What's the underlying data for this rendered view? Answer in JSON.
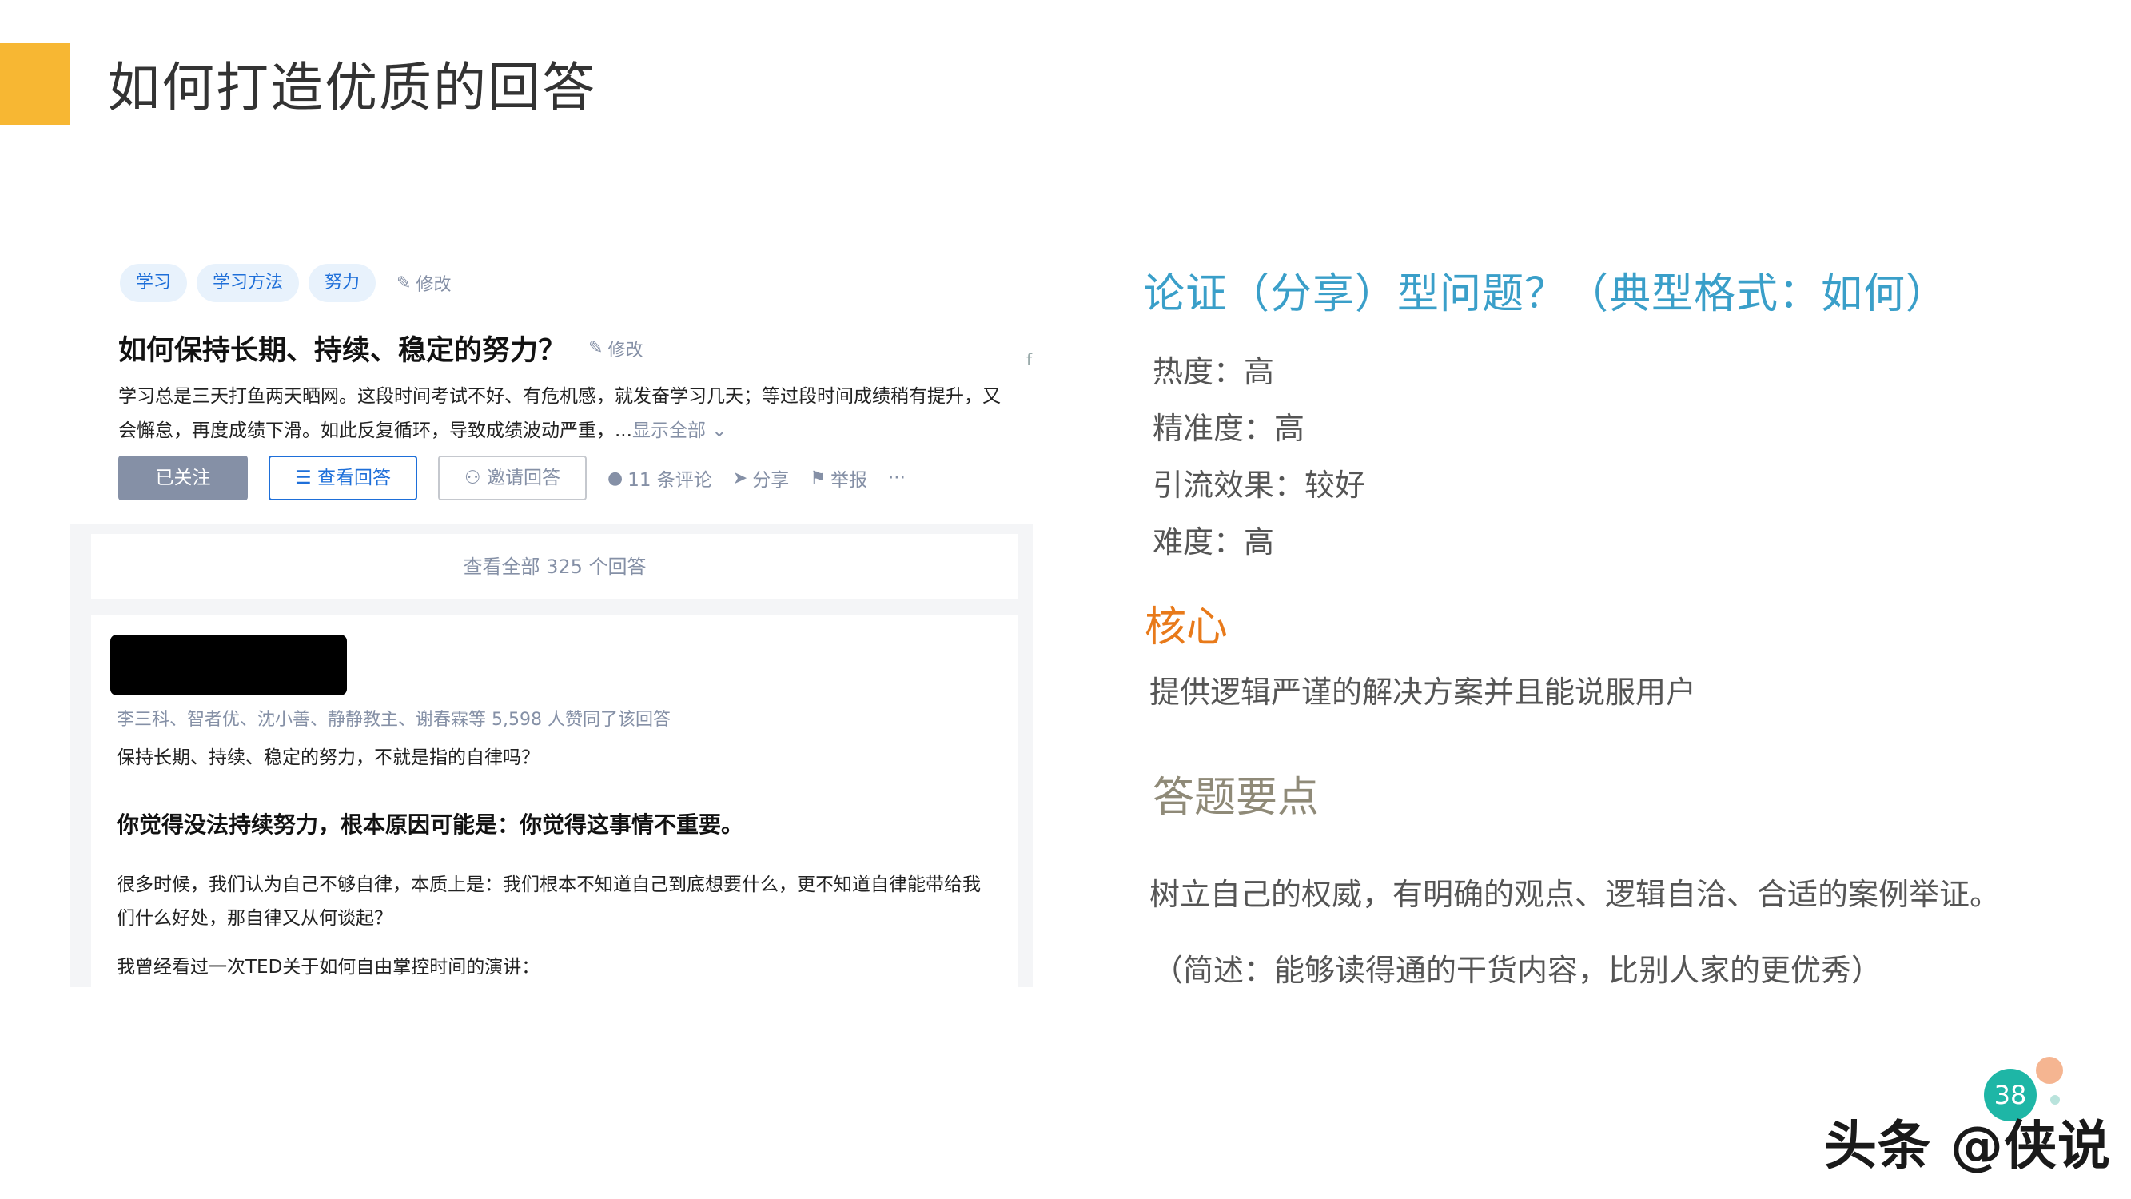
{
  "slide": {
    "title": "如何打造优质的回答",
    "page_number": "38",
    "watermark": "头条 @侠说"
  },
  "question_card": {
    "tags": [
      "学习",
      "学习方法",
      "努力"
    ],
    "edit_label": "修改",
    "title": "如何保持长期、持续、稳定的努力？",
    "description": "学习总是三天打鱼两天晒网。这段时间考试不好、有危机感，就发奋学习几天；等过段时间成绩稍有提升，又会懈怠，再度成绩下滑。如此反复循环，导致成绩波动严重，...",
    "show_all": "显示全部",
    "side_char": "f",
    "actions": {
      "followed": "已关注",
      "view_answers": "查看回答",
      "invite": "邀请回答",
      "comments": "11 条评论",
      "share": "分享",
      "report": "举报",
      "more": "···"
    },
    "view_all_answers": "查看全部 325 个回答",
    "answer": {
      "voters": "李三科、智者优、沈小善、静静教主、谢春霖等 5,598 人赞同了该回答",
      "p1": "保持长期、持续、稳定的努力，不就是指的自律吗？",
      "bold": "你觉得没法持续努力，根本原因可能是：你觉得这事情不重要。",
      "p2": "很多时候，我们认为自己不够自律，本质上是：我们根本不知道自己到底想要什么，更不知道自律能带给我们什么好处，那自律又从何谈起？",
      "p3": "我曾经看过一次TED关于如何自由掌控时间的演讲："
    }
  },
  "analysis": {
    "heading": "论证（分享）型问题？（典型格式：如何）",
    "metrics": [
      "热度：高",
      "精准度：高",
      "引流效果：较好",
      "难度：高"
    ],
    "core_label": "核心",
    "core_text": "提供逻辑严谨的解决方案并且能说服用户",
    "points_label": "答题要点",
    "points_text": "树立自己的权威，有明确的观点、逻辑自洽、合适的案例举证。",
    "points_note": "（简述：能够读得通的干货内容，比别人家的更优秀）"
  },
  "colors": {
    "accent_block": "#f7b733",
    "heading_blue": "#3a9fc9",
    "core_orange": "#e87a1a",
    "link_blue": "#1e6fd9",
    "page_badge": "#1eb6a6"
  }
}
